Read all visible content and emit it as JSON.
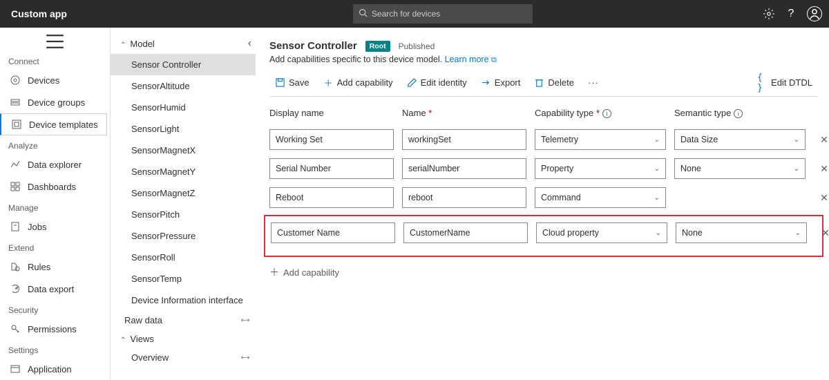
{
  "app": {
    "title": "Custom app"
  },
  "search": {
    "placeholder": "Search for devices"
  },
  "nav": {
    "connect": "Connect",
    "devices": "Devices",
    "device_groups": "Device groups",
    "device_templates": "Device templates",
    "analyze": "Analyze",
    "data_explorer": "Data explorer",
    "dashboards": "Dashboards",
    "manage": "Manage",
    "jobs": "Jobs",
    "extend": "Extend",
    "rules": "Rules",
    "data_export": "Data export",
    "security": "Security",
    "permissions": "Permissions",
    "settings": "Settings",
    "application": "Application"
  },
  "tree": {
    "model": "Model",
    "items": [
      "Sensor Controller",
      "SensorAltitude",
      "SensorHumid",
      "SensorLight",
      "SensorMagnetX",
      "SensorMagnetY",
      "SensorMagnetZ",
      "SensorPitch",
      "SensorPressure",
      "SensorRoll",
      "SensorTemp",
      "Device Information interface"
    ],
    "raw_data": "Raw data",
    "views": "Views",
    "overview": "Overview"
  },
  "main": {
    "title": "Sensor Controller",
    "root_badge": "Root",
    "published": "Published",
    "subtitle": "Add capabilities specific to this device model. ",
    "learn_more": "Learn more",
    "commands": {
      "save": "Save",
      "add_capability": "Add capability",
      "edit_identity": "Edit identity",
      "export": "Export",
      "delete": "Delete",
      "edit_dtdl": "Edit DTDL"
    },
    "columns": {
      "display_name": "Display name",
      "name": "Name",
      "capability_type": "Capability type",
      "semantic_type": "Semantic type"
    },
    "rows": [
      {
        "display_name": "Working Set",
        "name": "workingSet",
        "cap_type": "Telemetry",
        "semantic": "Data Size",
        "has_semantic": true
      },
      {
        "display_name": "Serial Number",
        "name": "serialNumber",
        "cap_type": "Property",
        "semantic": "None",
        "has_semantic": true
      },
      {
        "display_name": "Reboot",
        "name": "reboot",
        "cap_type": "Command",
        "semantic": "",
        "has_semantic": false
      },
      {
        "display_name": "Customer Name",
        "name": "CustomerName",
        "cap_type": "Cloud property",
        "semantic": "None",
        "has_semantic": true
      }
    ],
    "add_capability_row": "Add capability"
  }
}
